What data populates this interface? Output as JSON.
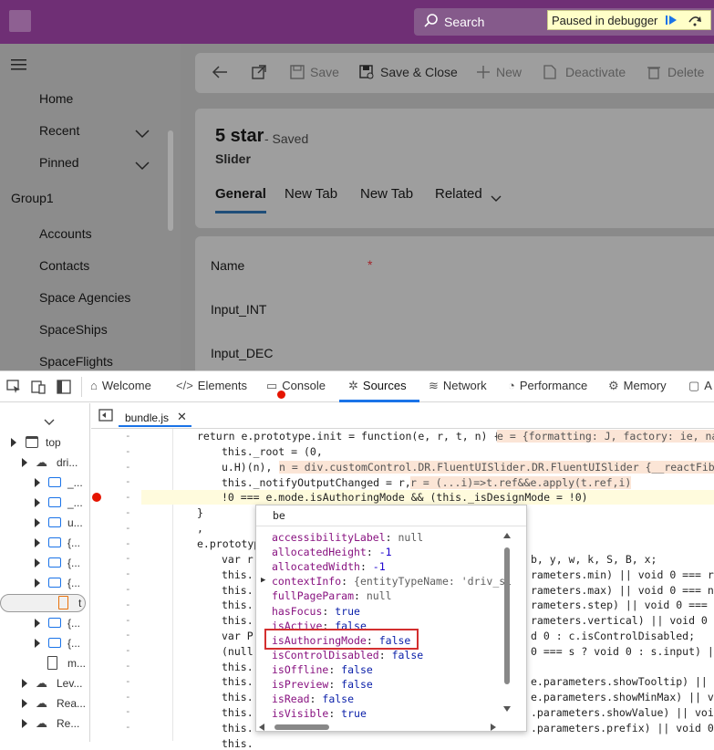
{
  "topbar": {
    "search_label": "Search",
    "debugger_status": "Paused in debugger"
  },
  "sidebar": {
    "items": [
      "Home",
      "Recent",
      "Pinned"
    ],
    "group_label": "Group1",
    "group_items": [
      "Accounts",
      "Contacts",
      "Space Agencies",
      "SpaceShips",
      "SpaceFlights"
    ]
  },
  "commandbar": {
    "save": "Save",
    "save_close": "Save & Close",
    "new": "New",
    "deactivate": "Deactivate",
    "delete": "Delete"
  },
  "record": {
    "title": "5 star",
    "status": "- Saved",
    "entity": "Slider",
    "tabs": [
      "General",
      "New Tab",
      "New Tab",
      "Related"
    ]
  },
  "form": {
    "fields": [
      "Name",
      "Input_INT",
      "Input_DEC"
    ],
    "required_marker": "*"
  },
  "devtools": {
    "tabs": [
      "Welcome",
      "Elements",
      "Console",
      "Sources",
      "Network",
      "Performance",
      "Memory",
      "A"
    ],
    "active_tab": "Sources",
    "file_tab": "bundle.js",
    "tree": [
      "top",
      "dri...",
      "_...",
      "_...",
      "u...",
      "{...",
      "{...",
      "{...",
      "t",
      "{...",
      "{...",
      "m...",
      "Lev...",
      "Rea...",
      "Re..."
    ],
    "gutter_marks": [
      "-",
      "-",
      "-",
      "-",
      "-",
      "-",
      "-",
      "-",
      "-",
      "-",
      "-",
      "-",
      "-",
      "-",
      "-",
      "-",
      "-",
      "-",
      "-",
      "-"
    ],
    "code_lines": [
      "return e.prototype.init = function(e, r, t, n) {",
      "this._root = (0,",
      "u.H)(n),",
      "this._notifyOutputChanged = r,",
      "!0 === e.mode.isAuthoringMode && (this._isDesignMode = !0)",
      "}",
      ",",
      "e.prototyp"
    ],
    "inline_values": [
      "e = {formatting: J, factory: ie, nav",
      "n = div.customControl.DR.FluentUISlider.DR.FluentUISlider {__reactFiber$",
      "r = (...i)=>t.ref&&e.apply(t.ref,i)"
    ],
    "right_code": [
      "b, y, w, k, S, B, x;",
      "rameters.min) || void 0 === r ?",
      "rameters.max) || void 0 === n ?",
      "rameters.step) || void 0 === a",
      "rameters.vertical) || void 0",
      "d 0 : c.isControlDisabled;",
      "0 === s ? void 0 : s.input) ||",
      "",
      "e.parameters.showTooltip) || vo",
      "e.parameters.showMinMax) || vo",
      ".parameters.showValue) || voi",
      ".parameters.prefix) || void 0 ="
    ],
    "left_code": [
      "var r",
      "this.",
      "this.",
      "this.",
      "this.",
      "var P",
      "(null",
      "this.",
      "this.",
      "this.",
      "this.",
      "this.",
      "this."
    ],
    "popup": {
      "filter": "be",
      "props": [
        {
          "key": "accessibilityLabel",
          "value": "null",
          "kind": "null"
        },
        {
          "key": "allocatedHeight",
          "value": "-1",
          "kind": "num"
        },
        {
          "key": "allocatedWidth",
          "value": "-1",
          "kind": "num"
        },
        {
          "key": "contextInfo",
          "value": "{entityTypeName: 'driv_sl",
          "kind": "obj"
        },
        {
          "key": "fullPageParam",
          "value": "null",
          "kind": "null"
        },
        {
          "key": "hasFocus",
          "value": "true",
          "kind": "bool"
        },
        {
          "key": "isActive",
          "value": "false",
          "kind": "bool"
        },
        {
          "key": "isAuthoringMode",
          "value": "false",
          "kind": "bool"
        },
        {
          "key": "isControlDisabled",
          "value": "false",
          "kind": "bool"
        },
        {
          "key": "isOffline",
          "value": "false",
          "kind": "bool"
        },
        {
          "key": "isPreview",
          "value": "false",
          "kind": "bool"
        },
        {
          "key": "isRead",
          "value": "false",
          "kind": "bool"
        },
        {
          "key": "isVisible",
          "value": "true",
          "kind": "bool"
        }
      ]
    }
  },
  "colors": {
    "brand": "#6f2f75",
    "accent": "#1a73e8",
    "highlight": "#d32f2f"
  }
}
